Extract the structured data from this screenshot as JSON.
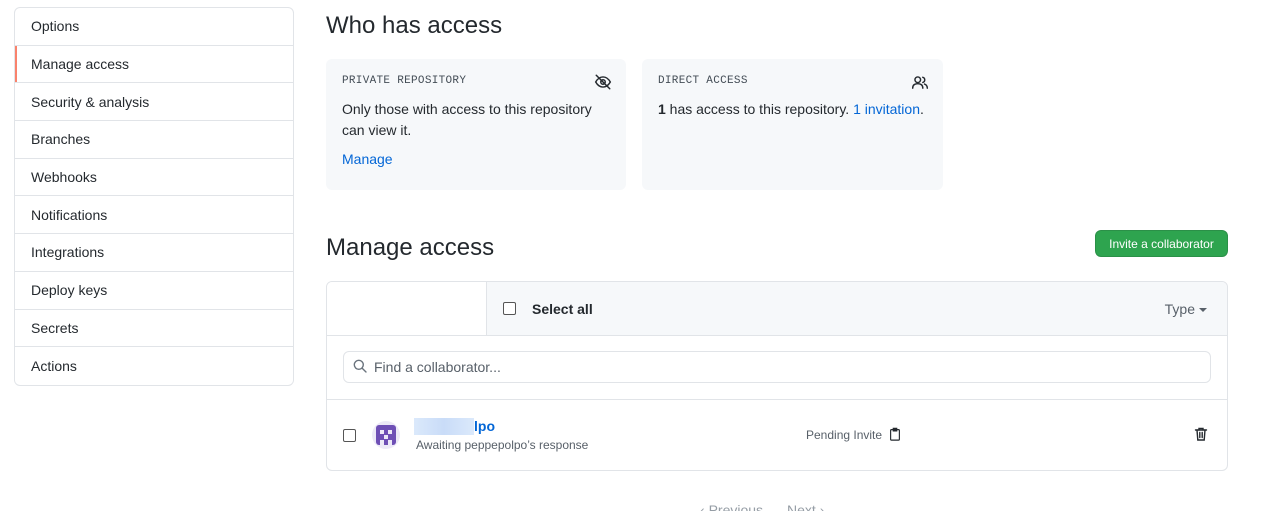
{
  "sidebar": {
    "items": [
      {
        "label": "Options"
      },
      {
        "label": "Manage access"
      },
      {
        "label": "Security & analysis"
      },
      {
        "label": "Branches"
      },
      {
        "label": "Webhooks"
      },
      {
        "label": "Notifications"
      },
      {
        "label": "Integrations"
      },
      {
        "label": "Deploy keys"
      },
      {
        "label": "Secrets"
      },
      {
        "label": "Actions"
      }
    ],
    "active": "Manage access"
  },
  "who_has_access": {
    "title": "Who has access",
    "private_card": {
      "kicker": "PRIVATE REPOSITORY",
      "text": "Only those with access to this repository can view it.",
      "link": "Manage",
      "icon": "eye-closed-icon"
    },
    "direct_card": {
      "kicker": "DIRECT ACCESS",
      "count": "1",
      "text": " has access to this repository. ",
      "link": "1 invitation",
      "tail": ".",
      "icon": "people-icon"
    }
  },
  "manage_access": {
    "title": "Manage access",
    "invite_button": "Invite a collaborator",
    "select_all": "Select all",
    "type_filter": "Type",
    "search_placeholder": "Find a collaborator...",
    "collaborators": [
      {
        "name_visible": "lpo",
        "subtitle": "Awaiting peppepolpo’s response",
        "status": "Pending Invite"
      }
    ]
  },
  "pagination": {
    "previous": "Previous",
    "next": "Next"
  },
  "colors": {
    "accent_link": "#0366d6",
    "invite_button": "#2ea44f",
    "active_marker": "#f9826c",
    "card_bg": "#f6f8fa"
  }
}
